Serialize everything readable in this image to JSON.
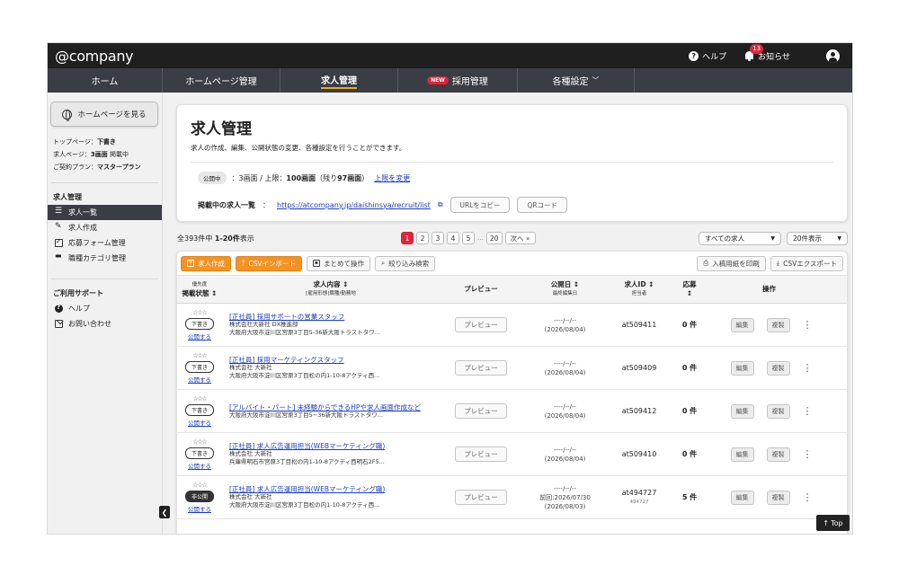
{
  "app": {
    "logo": "@company"
  },
  "topbar": {
    "help_label": "ヘルプ",
    "notice_label": "お知らせ",
    "notice_count": "13"
  },
  "nav": {
    "items": [
      {
        "label": "ホーム"
      },
      {
        "label": "ホームページ管理"
      },
      {
        "label": "求人管理"
      },
      {
        "label": "採用管理",
        "badge": "NEW"
      },
      {
        "label": "各種設定"
      }
    ]
  },
  "sidebar": {
    "hp_button": "ホームページを見る",
    "info": [
      {
        "label": "トップページ：",
        "value": "下書き"
      },
      {
        "label": "求人ページ：",
        "value": "3画面",
        "suffix": " 掲載中"
      },
      {
        "label": "ご契約プラン：",
        "value": "マスタープラン"
      }
    ],
    "section1": "求人管理",
    "items1": [
      "求人一覧",
      "求人作成",
      "応募フォーム管理",
      "職種カテゴリ管理"
    ],
    "section2": "ご利用サポート",
    "items2": [
      "ヘルプ",
      "お問い合わせ"
    ]
  },
  "header": {
    "title": "求人管理",
    "desc": "求人の作成、編集、公開状態の変更、各種設定を行うことができます。",
    "pub_pill": "公開中",
    "limit_pre": "：3画面 / 上限：",
    "limit_max": "100画面",
    "limit_remain_pre": "（残り",
    "limit_remain": "97画面",
    "limit_remain_post": "）",
    "limit_link": "上限を変更",
    "url_label": "掲載中の求人一覧",
    "url_colon": "：",
    "url": "https://atcompany.jp/daishinsya/recruit/list",
    "copy_btn": "URLをコピー",
    "qr_btn": "QRコード"
  },
  "listing": {
    "count_pre": "全393件中 ",
    "count_range": "1-20件",
    "count_post": "表示",
    "pages": [
      "1",
      "2",
      "3",
      "4",
      "5",
      "20"
    ],
    "dots": "…",
    "next": "次へ »",
    "filter": "すべての求人",
    "per_page": "20件表示"
  },
  "toolbar": {
    "create": "求人作成",
    "csv_import": "CSVインポート",
    "bulk": "まとめて操作",
    "filter": "絞り込み検索",
    "print": "入稿用紙を印刷",
    "csv_export": "CSVエクスポート"
  },
  "table": {
    "headers": {
      "priority": "優先度",
      "status": "掲載状態 ↕",
      "content": "求人内容 ↕",
      "content_sub": "[雇用形態]職種/勤務地",
      "preview": "プレビュー",
      "pubdate": "公開日 ↕",
      "pubdate_sub": "最終編集日",
      "jobid": "求人ID ↕",
      "jobid_sub": "担当者",
      "apply": "応募",
      "apply_sub": "↕",
      "actions": "操作"
    },
    "rows": [
      {
        "stars": "☆☆☆",
        "status": "下書き",
        "pub": "公開する",
        "title": "[正社員] 採用サポートの営業スタッフ",
        "line1": "株式会社大新社 DX推進部",
        "line2": "大阪府大阪市淀川区宮原3丁目5-36新大阪トラストタワ...",
        "preview": "プレビュー",
        "date1": "----/--/--",
        "date2": "(2026/08/04)",
        "id": "at509411",
        "id_sub": "",
        "apply": "0 件",
        "edit": "編集",
        "copy": "複製"
      },
      {
        "stars": "☆☆☆",
        "status": "下書き",
        "pub": "公開する",
        "title": "[正社員] 採用マーケティングスタッフ",
        "line1": "株式会社 大新社",
        "line2": "大阪府大阪市淀川区宮原3丁目松の内1-10-8アクティ西...",
        "preview": "プレビュー",
        "date1": "----/--/--",
        "date2": "(2026/08/04)",
        "id": "at509409",
        "id_sub": "",
        "apply": "0 件",
        "edit": "編集",
        "copy": "複製"
      },
      {
        "stars": "☆☆☆",
        "status": "下書き",
        "pub": "公開する",
        "title": "[アルバイト・パート] 未経験からできるHPや求人画面作成など",
        "line1": "",
        "line2": "大阪府大阪市淀川区宮原3丁目5−36新大阪トラストタワ...",
        "preview": "プレビュー",
        "date1": "----/--/--",
        "date2": "(2026/08/04)",
        "id": "at509412",
        "id_sub": "",
        "apply": "0 件",
        "edit": "編集",
        "copy": "複製"
      },
      {
        "stars": "☆☆☆",
        "status": "下書き",
        "pub": "公開する",
        "title": "[正社員] 求人広告運用担当(WEBマーケティング職)",
        "line1": "株式会社 大新社",
        "line2": "兵庫県明石市宮原3丁目松の内1-10-8アクティ西明石2F5...",
        "preview": "プレビュー",
        "date1": "----/--/--",
        "date2": "(2026/08/04)",
        "id": "at509410",
        "id_sub": "",
        "apply": "0 件",
        "edit": "編集",
        "copy": "複製"
      },
      {
        "stars": "☆☆☆",
        "status": "非公開",
        "pub": "公開する",
        "title": "[正社員] 求人広告運用担当(WEBマーケティング職)",
        "line1": "株式会社 大新社",
        "line2": "大阪府大阪市淀川区宮原3丁目松の内1-10-8アクティ西...",
        "preview": "プレビュー",
        "date1": "----/--/--",
        "date2": "前回:2026/07/30",
        "date3": "(2026/08/03)",
        "id": "at494727",
        "id_sub": "494727",
        "apply": "5 件",
        "edit": "編集",
        "copy": "複製"
      }
    ]
  },
  "top_button": "Top"
}
